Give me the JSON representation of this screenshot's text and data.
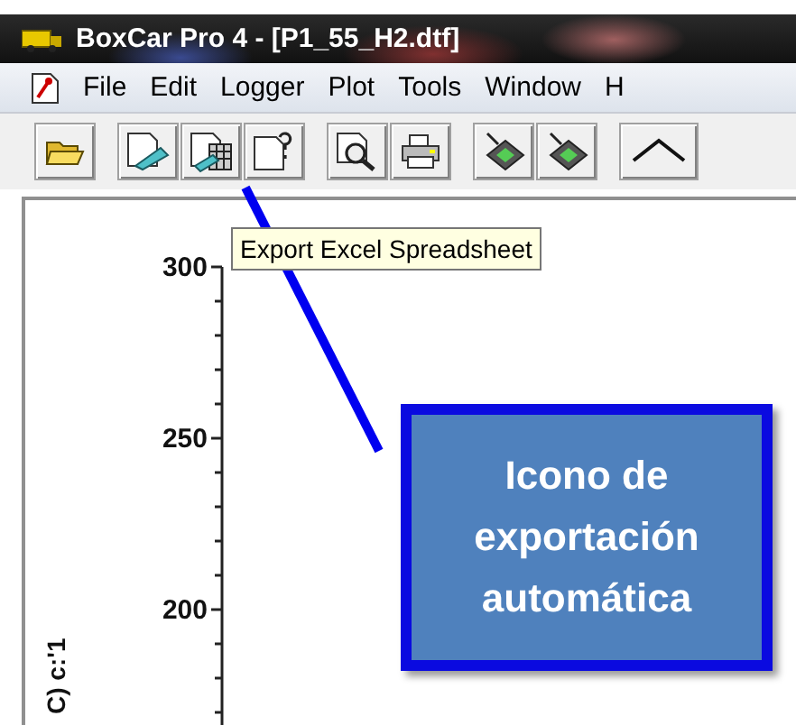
{
  "window": {
    "title": "BoxCar Pro 4 - [P1_55_H2.dtf]"
  },
  "menu": [
    "File",
    "Edit",
    "Logger",
    "Plot",
    "Tools",
    "Window",
    "H"
  ],
  "tooltip": "Export Excel Spreadsheet",
  "y_axis": {
    "label": "C) c:'1",
    "ticks": [
      "300",
      "250",
      "200"
    ]
  },
  "callout": "Icono de exportación automática"
}
